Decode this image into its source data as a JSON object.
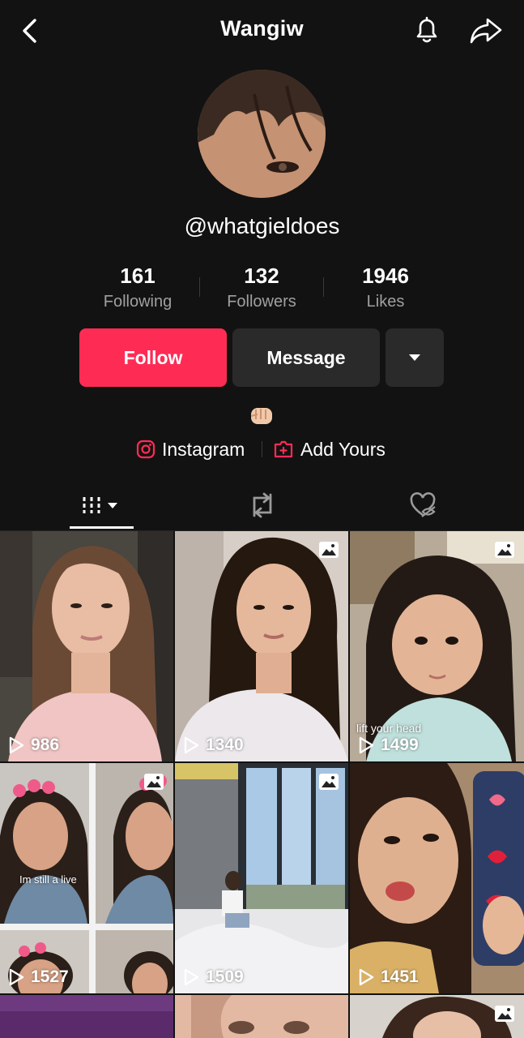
{
  "header": {
    "title": "Wangiw"
  },
  "profile": {
    "handle": "@whatgieldoes",
    "stats": [
      {
        "value": "161",
        "label": "Following"
      },
      {
        "value": "132",
        "label": "Followers"
      },
      {
        "value": "1946",
        "label": "Likes"
      }
    ],
    "bio_emoji": "👊🏻"
  },
  "actions": {
    "follow": "Follow",
    "message": "Message"
  },
  "links": {
    "instagram": "Instagram",
    "add_yours": "Add Yours"
  },
  "tabs": [
    "videos-tab",
    "reposts-tab",
    "liked-tab"
  ],
  "colors": {
    "accent": "#fe2c55",
    "background": "#121212",
    "button": "#2a2a2a"
  },
  "grid": [
    {
      "views": "986",
      "photo": false,
      "caption": ""
    },
    {
      "views": "1340",
      "photo": true,
      "caption": ""
    },
    {
      "views": "1499",
      "photo": true,
      "caption": "lift your head"
    },
    {
      "views": "1527",
      "photo": true,
      "caption": "Im still a live"
    },
    {
      "views": "1509",
      "photo": true,
      "caption": ""
    },
    {
      "views": "1451",
      "photo": false,
      "caption": ""
    },
    {
      "views": "",
      "photo": false,
      "caption": ""
    },
    {
      "views": "",
      "photo": false,
      "caption": ""
    },
    {
      "views": "",
      "photo": true,
      "caption": ""
    }
  ]
}
